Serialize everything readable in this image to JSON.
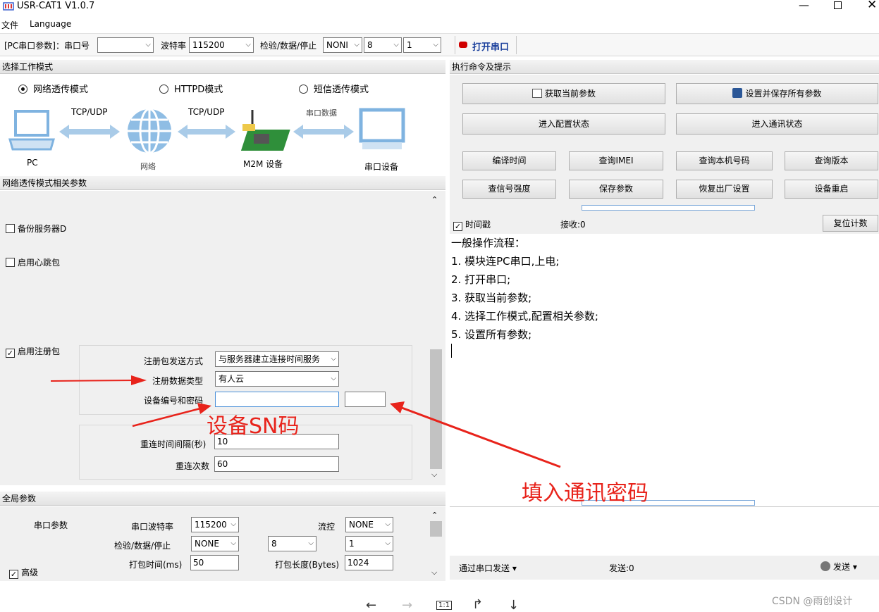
{
  "window": {
    "title": "USR-CAT1 V1.0.7"
  },
  "menu": {
    "file": "文件",
    "language": "Language"
  },
  "toolbar": {
    "pc_label": "[PC串口参数]：串口号",
    "port_value": "",
    "baud_label": "波特率",
    "baud_value": "115200",
    "check_label": "检验/数据/停止",
    "parity_value": "NONI",
    "databits_value": "8",
    "stopbits_value": "1",
    "open_port": "打开串口",
    "open_port_color": "#d00000"
  },
  "work_mode": {
    "heading": "选择工作模式",
    "modes": [
      "网络透传模式",
      "HTTPD模式",
      "短信透传模式"
    ],
    "selected": "网络透传模式",
    "diagram": {
      "pc": "PC",
      "proto1": "TCP/UDP",
      "network": "网络",
      "proto2": "TCP/UDP",
      "device": "M2M 设备",
      "serial_data": "串口数据",
      "serial_device": "串口设备"
    }
  },
  "net_params": {
    "heading": "网络透传模式相关参数",
    "backup_server": {
      "label": "备份服务器D",
      "checked": false
    },
    "heartbeat": {
      "label": "启用心跳包",
      "checked": false
    },
    "register": {
      "label": "启用注册包",
      "checked": true,
      "check_mark": "✓"
    },
    "reg_send_label": "注册包发送方式",
    "reg_send_value": "与服务器建立连接时间服务",
    "reg_type_label": "注册数据类型",
    "reg_type_value": "有人云",
    "device_id_label": "设备编号和密码",
    "device_id_value": "",
    "device_pwd_value": "",
    "reconnect_interval_label": "重连时间间隔(秒)",
    "reconnect_interval_value": "10",
    "reconnect_count_label": "重连次数",
    "reconnect_count_value": "60"
  },
  "global": {
    "heading": "全局参数",
    "serial_params": "串口参数",
    "baud_label": "串口波特率",
    "baud_value": "115200",
    "flow_label": "流控",
    "flow_value": "NONE",
    "check_label": "检验/数据/停止",
    "parity_value": "NONE",
    "databits_value": "8",
    "stopbits_value": "1",
    "pack_time_label": "打包时间(ms)",
    "pack_time_value": "50",
    "pack_len_label": "打包长度(Bytes)",
    "pack_len_value": "1024",
    "advanced": "高级",
    "advanced_check": "✓"
  },
  "commands": {
    "heading": "执行命令及提示",
    "get_params": "获取当前参数",
    "save_all": "设置并保存所有参数",
    "enter_config": "进入配置状态",
    "enter_comm": "进入通讯状态",
    "compile_time": "编译时间",
    "query_imei": "查询IMEI",
    "query_number": "查询本机号码",
    "query_version": "查询版本",
    "signal": "查信号强度",
    "save_params": "保存参数",
    "factory_reset": "恢复出厂设置",
    "reboot": "设备重启"
  },
  "log": {
    "timestamp_label": "时间戳",
    "timestamp_check": "✓",
    "recv": "接收:0",
    "reset_count": "复位计数",
    "lines": [
      "一般操作流程：",
      "1. 模块连PC串口,上电;",
      "2. 打开串口;",
      "3. 获取当前参数;",
      "4. 选择工作模式,配置相关参数;",
      "5. 设置所有参数;"
    ]
  },
  "send": {
    "mode": "通过串口发送",
    "sent": "发送:0",
    "send_btn": "发送"
  },
  "annotations": {
    "sn": "设备SN码",
    "pwd": "填入通讯密码",
    "color": "#e8231b"
  },
  "viewer": {
    "back": "←",
    "forward": "→",
    "fit": "1:1",
    "rotate": "↱",
    "down": "↓"
  },
  "watermark": "CSDN @雨创设计"
}
